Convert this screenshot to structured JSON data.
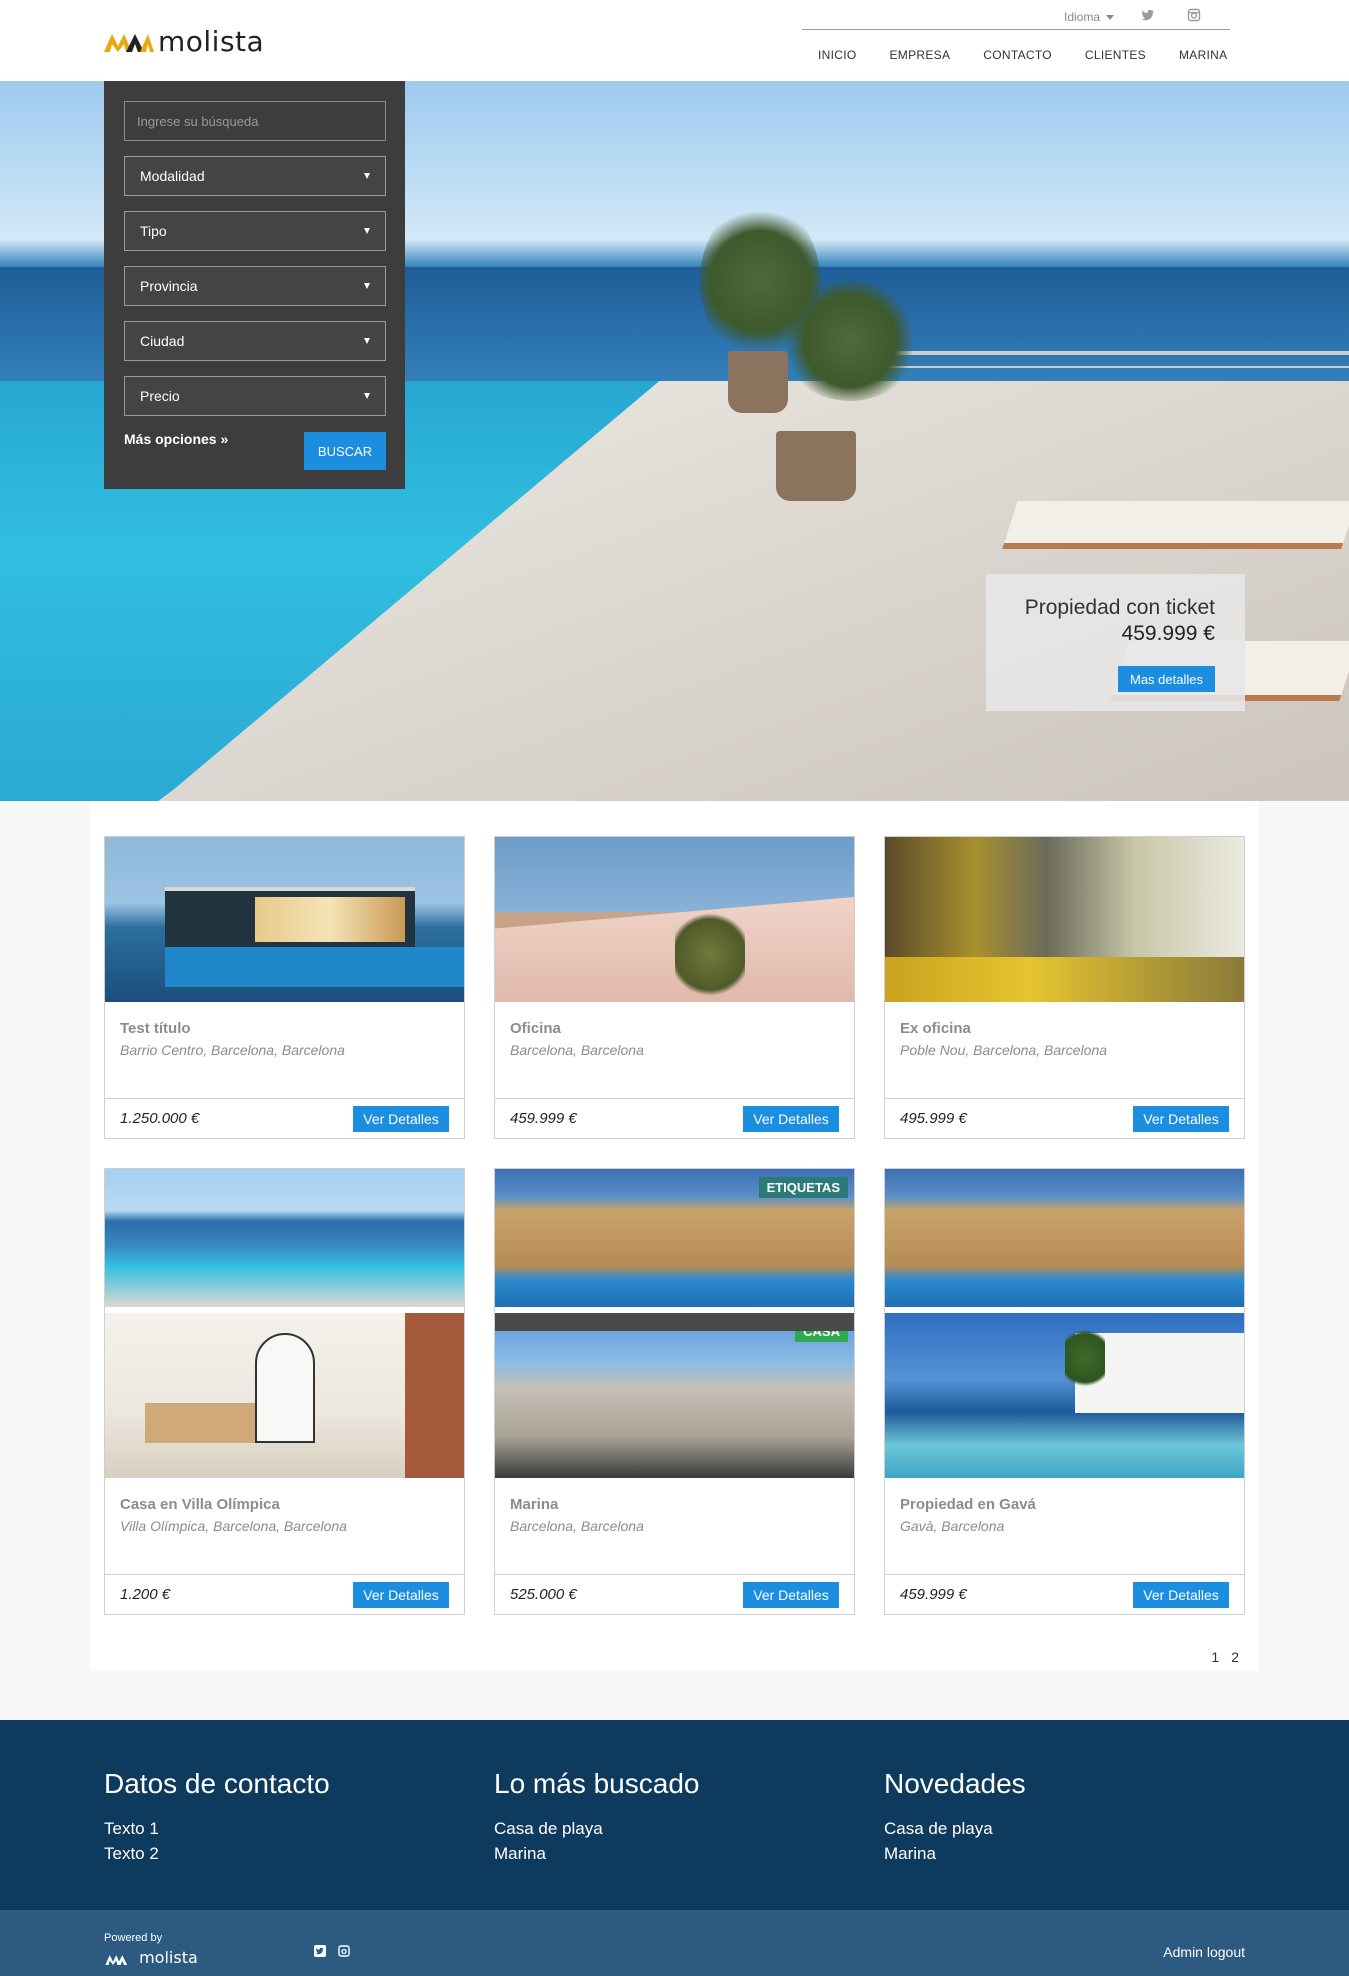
{
  "header": {
    "logo_text": "molista",
    "language_label": "Idioma",
    "nav": [
      "INICIO",
      "EMPRESA",
      "CONTACTO",
      "CLIENTES",
      "MARINA"
    ]
  },
  "search": {
    "placeholder": "Ingrese su búsqueda",
    "selects": [
      "Modalidad",
      "Tipo",
      "Provincia",
      "Ciudad",
      "Precio"
    ],
    "more_options": "Más opciones »",
    "submit_label": "BUSCAR"
  },
  "featured": {
    "title": "Propiedad con ticket",
    "price": "459.999 €",
    "button": "Mas detalles"
  },
  "properties": [
    {
      "title": "Test título",
      "location": "Barrio Centro, Barcelona, Barcelona",
      "price": "1.250.000 €",
      "button": "Ver Detalles"
    },
    {
      "title": "Oficina",
      "location": "Barcelona, Barcelona",
      "price": "459.999 €",
      "button": "Ver Detalles"
    },
    {
      "title": "Ex oficina",
      "location": "Poble Nou, Barcelona, Barcelona",
      "price": "495.999 €",
      "button": "Ver Detalles"
    },
    {
      "title": "Casa en Villa Olímpica",
      "location": "Villa Olímpica, Barcelona, Barcelona",
      "price": "1.200 €",
      "button": "Ver Detalles"
    },
    {
      "title": "Marina",
      "location": "Barcelona, Barcelona",
      "price": "525.000 €",
      "button": "Ver Detalles",
      "tags": [
        "ETIQUETAS",
        "CASA"
      ]
    },
    {
      "title": "Propiedad en Gavá",
      "location": "Gavà, Barcelona",
      "price": "459.999 €",
      "button": "Ver Detalles"
    }
  ],
  "tag_colors": {
    "etiquetas": "#2a7a7a",
    "casa": "#2fa84f"
  },
  "pagination": [
    "1",
    "2"
  ],
  "footer": {
    "contact": {
      "title": "Datos de contacto",
      "lines": [
        "Texto 1",
        "Texto 2"
      ]
    },
    "popular": {
      "title": "Lo más buscado",
      "lines": [
        "Casa de playa",
        "Marina"
      ]
    },
    "news": {
      "title": "Novedades",
      "lines": [
        "Casa de playa",
        "Marina"
      ]
    }
  },
  "bottom": {
    "powered_by": "Powered by",
    "powered_logo": "molista",
    "admin_link": "Admin logout"
  },
  "colors": {
    "accent": "#1b8ee0",
    "footer": "#0e3a5d",
    "bottom_bar": "#2d5a80",
    "logo_gold": "#e8a90c"
  }
}
